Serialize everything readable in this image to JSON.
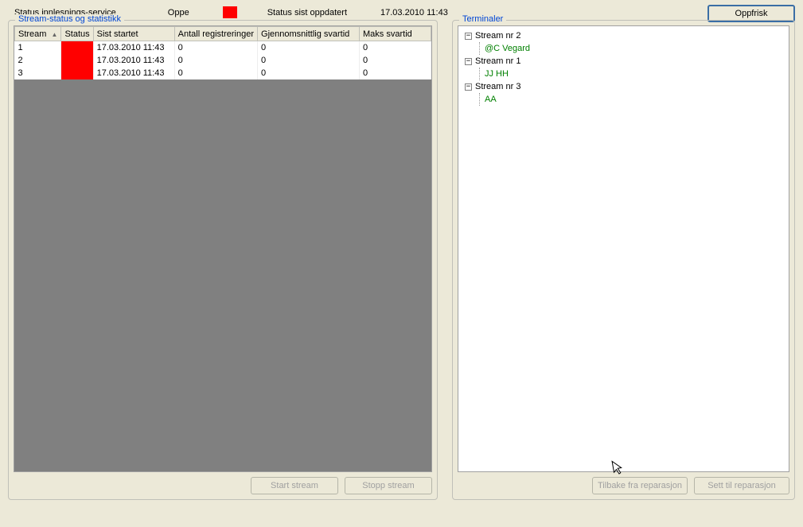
{
  "topbar": {
    "service_label": "Status innlesnings-service",
    "status_text": "Oppe",
    "updated_label": "Status sist oppdatert",
    "updated_value": "17.03.2010 11:43",
    "refresh_label": "Oppfrisk",
    "status_color": "#ff0000"
  },
  "left": {
    "legend": "Stream-status og statistikk",
    "columns": {
      "stream": "Stream",
      "status": "Status",
      "started": "Sist startet",
      "reg": "Antall registreringer",
      "avg": "Gjennomsnittlig svartid",
      "max": "Maks svartid"
    },
    "rows": [
      {
        "stream": "1",
        "started": "17.03.2010 11:43",
        "reg": "0",
        "avg": "0",
        "max": "0"
      },
      {
        "stream": "2",
        "started": "17.03.2010 11:43",
        "reg": "0",
        "avg": "0",
        "max": "0"
      },
      {
        "stream": "3",
        "started": "17.03.2010 11:43",
        "reg": "0",
        "avg": "0",
        "max": "0"
      }
    ],
    "buttons": {
      "start": "Start stream",
      "stop": "Stopp stream"
    }
  },
  "right": {
    "legend": "Terminaler",
    "nodes": [
      {
        "label": "Stream nr 2",
        "child": "@C Vegard"
      },
      {
        "label": "Stream nr 1",
        "child": "JJ HH"
      },
      {
        "label": "Stream nr 3",
        "child": "AA"
      }
    ],
    "buttons": {
      "back": "Tilbake fra reparasjon",
      "send": "Sett til reparasjon"
    }
  }
}
